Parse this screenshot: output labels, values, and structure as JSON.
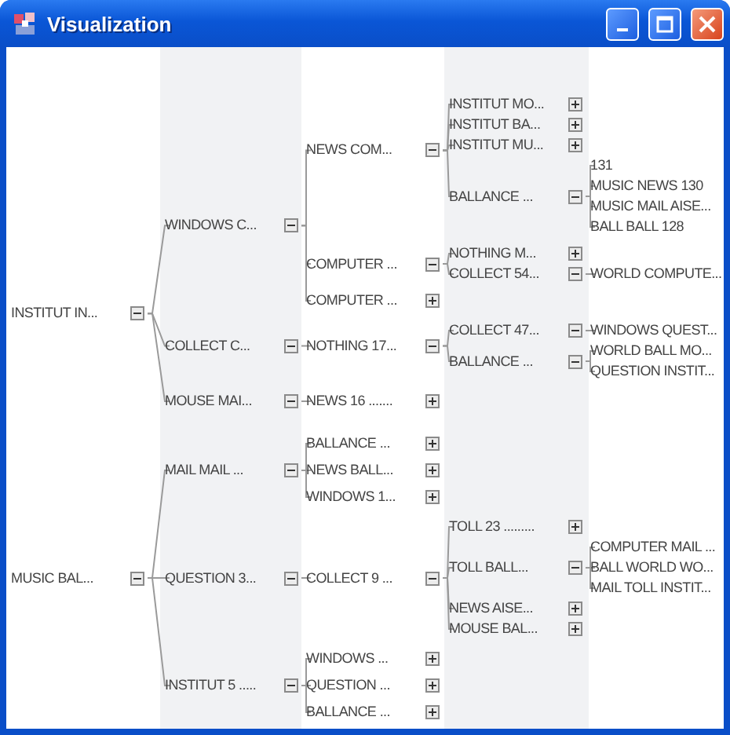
{
  "window": {
    "title": "Visualization"
  },
  "tree": [
    {
      "label": "INSTITUT IN...",
      "expanded": true,
      "children": [
        {
          "label": "WINDOWS C...",
          "expanded": true,
          "children": [
            {
              "label": "NEWS COM...",
              "expanded": true,
              "children": [
                {
                  "label": "INSTITUT MO...",
                  "expanded": false
                },
                {
                  "label": "INSTITUT BA...",
                  "expanded": false
                },
                {
                  "label": "INSTITUT MU...",
                  "expanded": false
                },
                {
                  "label": "BALLANCE ...",
                  "expanded": true,
                  "children": [
                    {
                      "label": "131"
                    },
                    {
                      "label": "MUSIC NEWS 130"
                    },
                    {
                      "label": "MUSIC MAIL AISE..."
                    },
                    {
                      "label": "BALL BALL 128"
                    }
                  ]
                }
              ]
            },
            {
              "label": "COMPUTER ...",
              "expanded": true,
              "children": [
                {
                  "label": "NOTHING M...",
                  "expanded": false
                },
                {
                  "label": "COLLECT 54...",
                  "expanded": true,
                  "children": [
                    {
                      "label": "WORLD COMPUTE..."
                    }
                  ]
                }
              ]
            },
            {
              "label": "COMPUTER ...",
              "expanded": false
            }
          ]
        },
        {
          "label": "COLLECT C...",
          "expanded": true,
          "children": [
            {
              "label": "NOTHING 17...",
              "expanded": true,
              "children": [
                {
                  "label": "COLLECT 47...",
                  "expanded": true,
                  "children": [
                    {
                      "label": "WINDOWS QUEST..."
                    }
                  ]
                },
                {
                  "label": "BALLANCE ...",
                  "expanded": true,
                  "children": [
                    {
                      "label": "WORLD BALL MO..."
                    },
                    {
                      "label": "QUESTION INSTIT..."
                    }
                  ]
                }
              ]
            }
          ]
        },
        {
          "label": "MOUSE MAI...",
          "expanded": true,
          "children": [
            {
              "label": "NEWS 16 .......",
              "expanded": false
            }
          ]
        }
      ]
    },
    {
      "label": "MUSIC BAL...",
      "expanded": true,
      "children": [
        {
          "label": "MAIL MAIL ...",
          "expanded": true,
          "children": [
            {
              "label": "BALLANCE ...",
              "expanded": false
            },
            {
              "label": "NEWS BALL...",
              "expanded": false
            },
            {
              "label": "WINDOWS 1...",
              "expanded": false
            }
          ]
        },
        {
          "label": "QUESTION 3...",
          "expanded": true,
          "children": [
            {
              "label": "COLLECT 9 ...",
              "expanded": true,
              "children": [
                {
                  "label": "TOLL 23 .........",
                  "expanded": false
                },
                {
                  "label": "TOLL BALL...",
                  "expanded": true,
                  "children": [
                    {
                      "label": "COMPUTER MAIL ..."
                    },
                    {
                      "label": "BALL WORLD WO..."
                    },
                    {
                      "label": "MAIL TOLL INSTIT..."
                    }
                  ]
                },
                {
                  "label": "NEWS AISE...",
                  "expanded": false
                },
                {
                  "label": "MOUSE BAL...",
                  "expanded": false
                }
              ]
            }
          ]
        },
        {
          "label": "INSTITUT 5 .....",
          "expanded": true,
          "children": [
            {
              "label": "WINDOWS ...",
              "expanded": false
            },
            {
              "label": "QUESTION ...",
              "expanded": false
            },
            {
              "label": "BALLANCE ...",
              "expanded": false
            }
          ]
        }
      ]
    }
  ]
}
